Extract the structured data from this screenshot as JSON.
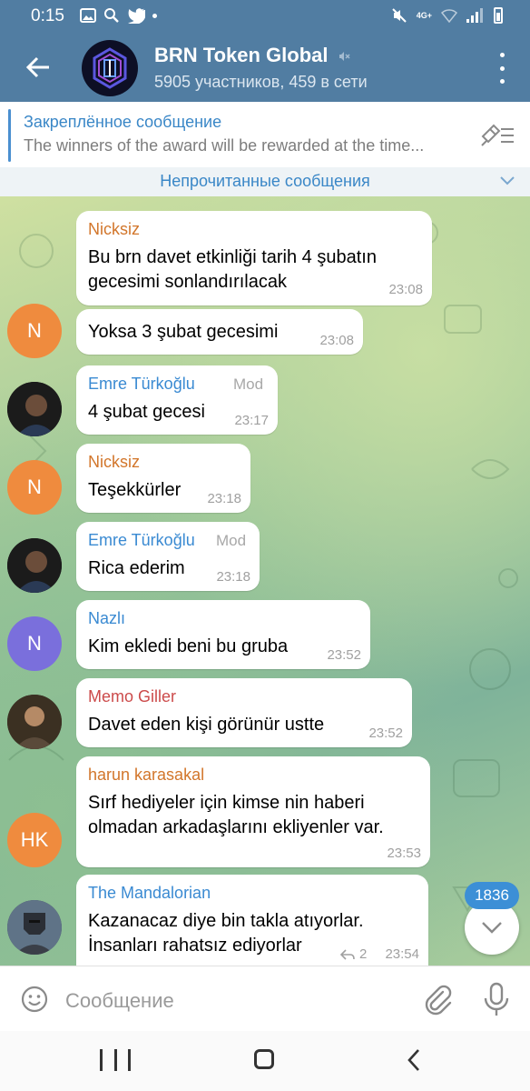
{
  "status_bar": {
    "time": "0:15",
    "network": "4G+",
    "icons": [
      "gallery-icon",
      "search-icon",
      "twitter-icon",
      "dot-icon",
      "mute-icon",
      "wifi-icon",
      "signal-icon",
      "battery-icon"
    ]
  },
  "header": {
    "title": "BRN Token Global",
    "subtitle": "5905 участников, 459 в сети",
    "accent": "#517da2"
  },
  "pinned": {
    "title": "Закреплённое сообщение",
    "text": "The winners of the award will be rewarded at the time..."
  },
  "unread_divider": "Непрочитанные сообщения",
  "messages": [
    {
      "sender": "Nicksiz",
      "sender_color": "#d2762b",
      "lines": [
        "Bu brn davet etkinliği tarih 4 şubatın",
        "gecesimi sonlandırılacak"
      ],
      "time": "23:08",
      "avatar_letter": ""
    },
    {
      "sender": "",
      "lines": [
        "Yoksa 3 şubat gecesimi"
      ],
      "time": "23:08",
      "avatar_letter": "N",
      "avatar_color": "#ef8b3e"
    },
    {
      "sender": "Emre Türkoğlu",
      "sender_color": "#3a8ad2",
      "role": "Mod",
      "lines": [
        "4 şubat gecesi"
      ],
      "time": "23:17"
    },
    {
      "sender": "Nicksiz",
      "sender_color": "#d2762b",
      "lines": [
        "Teşekkürler"
      ],
      "time": "23:18",
      "avatar_letter": "N",
      "avatar_color": "#ef8b3e"
    },
    {
      "sender": "Emre Türkoğlu",
      "sender_color": "#3a8ad2",
      "role": "Mod",
      "lines": [
        "Rica ederim"
      ],
      "time": "23:18"
    },
    {
      "sender": "Nazlı",
      "sender_color": "#3a8ad2",
      "lines": [
        "Kim ekledi beni bu gruba"
      ],
      "time": "23:52",
      "avatar_letter": "N",
      "avatar_color": "#7a6fdc"
    },
    {
      "sender": "Memo Giller",
      "sender_color": "#cc4b4b",
      "lines": [
        "Davet eden kişi görünür ustte"
      ],
      "time": "23:52"
    },
    {
      "sender": "harun karasakal",
      "sender_color": "#d2762b",
      "lines": [
        "Sırf hediyeler için kimse nin haberi",
        "olmadan arkadaşlarını ekliyenler var."
      ],
      "time": "23:53",
      "avatar_letter": "HK",
      "avatar_color": "#ef8b3e"
    },
    {
      "sender": "The Mandalorian",
      "sender_color": "#3a8ad2",
      "lines": [
        "Kazanacaz diye bin takla atıyorlar.",
        "İnsanları rahatsız ediyorlar"
      ],
      "time": "23:54",
      "replies": "2"
    }
  ],
  "scroll_badge": "1836",
  "composer": {
    "placeholder": "Сообщение"
  }
}
